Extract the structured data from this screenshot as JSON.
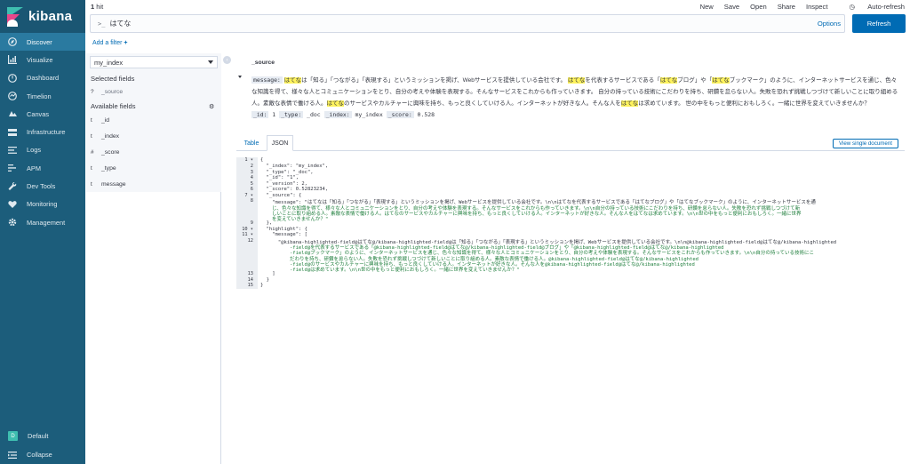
{
  "brand": {
    "name": "kibana"
  },
  "nav": {
    "items": [
      {
        "label": "Discover",
        "icon": "compass-icon"
      },
      {
        "label": "Visualize",
        "icon": "bar-chart-icon"
      },
      {
        "label": "Dashboard",
        "icon": "dashboard-icon"
      },
      {
        "label": "Timelion",
        "icon": "timelion-icon"
      },
      {
        "label": "Canvas",
        "icon": "canvas-icon"
      },
      {
        "label": "Infrastructure",
        "icon": "infrastructure-icon"
      },
      {
        "label": "Logs",
        "icon": "logs-icon"
      },
      {
        "label": "APM",
        "icon": "apm-icon"
      },
      {
        "label": "Dev Tools",
        "icon": "wrench-icon"
      },
      {
        "label": "Monitoring",
        "icon": "heart-icon"
      },
      {
        "label": "Management",
        "icon": "gear-icon"
      }
    ],
    "space_label": "Default",
    "space_initial": "D",
    "collapse_label": "Collapse"
  },
  "topbar": {
    "hits_count": "1",
    "hits_label": "hit",
    "menu": [
      "New",
      "Save",
      "Open",
      "Share",
      "Inspect",
      "Auto-refresh"
    ]
  },
  "query": {
    "prompt": ">_",
    "value": "はてな",
    "options_label": "Options",
    "refresh_label": "Refresh"
  },
  "filter": {
    "add_label": "Add a filter",
    "plus": "+"
  },
  "fields": {
    "index_pattern": "my_index",
    "selected_title": "Selected fields",
    "selected": [
      {
        "type": "?",
        "name": "_source"
      }
    ],
    "available_title": "Available fields",
    "available": [
      {
        "type": "t",
        "name": "_id"
      },
      {
        "type": "t",
        "name": "_index"
      },
      {
        "type": "#",
        "name": "_score"
      },
      {
        "type": "t",
        "name": "_type"
      },
      {
        "type": "t",
        "name": "message"
      }
    ]
  },
  "document": {
    "column_header": "_source",
    "message_key": "message:",
    "segments": [
      {
        "t": "はてな",
        "hl": true
      },
      {
        "t": "は「知る」「つながる」「表現する」というミッションを掲げ、Webサービスを提供している会社です。 ",
        "hl": false
      },
      {
        "t": "はてな",
        "hl": true
      },
      {
        "t": "を代表するサービスである「",
        "hl": false
      },
      {
        "t": "はてな",
        "hl": true
      },
      {
        "t": "ブログ」や「",
        "hl": false
      },
      {
        "t": "はてな",
        "hl": true
      },
      {
        "t": "ブックマーク」のように、インターネットサービスを通じ、色々な知識を得て、様々な人とコミュニケーションをとり、自分の考えや体験を表現する。そんなサービスをこれからも作っていきます。 自分の持っている技術にこだわりを持ち、研鑽を怠らない人。失敗を恐れず挑戦しつづけて新しいことに取り組める人。素敵な表情で働ける人。",
        "hl": false
      },
      {
        "t": "はてな",
        "hl": true
      },
      {
        "t": "のサービスやカルチャーに興味を持ち、もっと良くしていける人。インターネットが好きな人。そんな人を",
        "hl": false
      },
      {
        "t": "はてな",
        "hl": true
      },
      {
        "t": "は求めています。 世の中をもっと便利におもしろく。一緒に世界を変えていきませんか？",
        "hl": false
      }
    ],
    "meta": [
      {
        "key": "_id:",
        "value": "1"
      },
      {
        "key": "_type:",
        "value": "_doc"
      },
      {
        "key": "_index:",
        "value": "my_index"
      },
      {
        "key": "_score:",
        "value": "0.528"
      }
    ],
    "tabs": [
      "Table",
      "JSON"
    ],
    "view_single_label": "View single document"
  },
  "json_view": {
    "line_numbers": [
      "1 ▾",
      "2",
      "3",
      "4",
      "5",
      "6",
      "7 ▾",
      "8",
      "9",
      "10 ▾",
      "11 ▾",
      "12",
      "13",
      "14",
      "15"
    ],
    "lines": [
      "{",
      "  \"_index\": \"my_index\",",
      "  \"_type\": \"_doc\",",
      "  \"_id\": \"1\",",
      "  \"_version\": 2,",
      "  \"_score\": 0.52823234,",
      "  \"_source\": {",
      "    \"message\": \"はてなは「知る」「つながる」「表現する」というミッションを掲げ、Webサービスを提供している会社です。\\n\\nはてなを代表するサービスである「はてなブログ」や「はてなブックマーク」のように、インターネットサービスを通",
      "  },",
      "  \"highlight\": {",
      "    \"message\": [",
      "      \"@kibana-highlighted-field@はてな@/kibana-highlighted-field@は「知る」「つながる」「表現する」というミッションを掲げ、Webサービスを提供している会社です。\\n\\n@kibana-highlighted-field@はてな@/kibana-highlighted",
      "    ]",
      "  }",
      "}"
    ],
    "message_cont": [
      "じ、色々な知識を得て、様々な人とコミュニケーションをとり、自分の考えや体験を表現する。そんなサービスをこれからも作っていきます。\\n\\n自分の持っている技術にこだわりを持ち、研鑽を怠らない人。失敗を恐れず挑戦しつづけて新",
      "しいことに取り組める人。素敵な表情で働ける人。はてなのサービスやカルチャーに興味を持ち、もっと良くしていける人。インターネットが好きな人。そんな人をはてなは求めています。\\n\\n世の中をもっと便利におもしろく。一緒に世界",
      "を変えていきませんか？\""
    ],
    "highlight_cont": [
      "-field@を代表するサービスである「@kibana-highlighted-field@はてな@/kibana-highlighted-field@ブログ」や「@kibana-highlighted-field@はてな@/kibana-highlighted",
      "-field@ブックマーク」のように、インターネットサービスを通じ、色々な知識を得て、様々な人とコミュニケーションをとり、自分の考えや体験を表現する。そんなサービスをこれからも作っていきます。\\n\\n自分の持っている技術にこ",
      "だわりを持ち、研鑽を怠らない人。失敗を恐れず挑戦しつづけて新しいことに取り組める人。素敵な表情で働ける人。@kibana-highlighted-field@はてな@/kibana-highlighted",
      "-field@のサービスやカルチャーに興味を持ち、もっと良くしていける人。インターネットが好きな人。そんな人を@kibana-highlighted-field@はてな@/kibana-highlighted",
      "-field@は求めています。\\n\\n世の中をもっと便利におもしろく。一緒に世界を変えていきませんか？\""
    ]
  },
  "colors": {
    "sidebar": "#1c5d7b",
    "accent": "#006bb4",
    "highlight": "#fff35c"
  }
}
